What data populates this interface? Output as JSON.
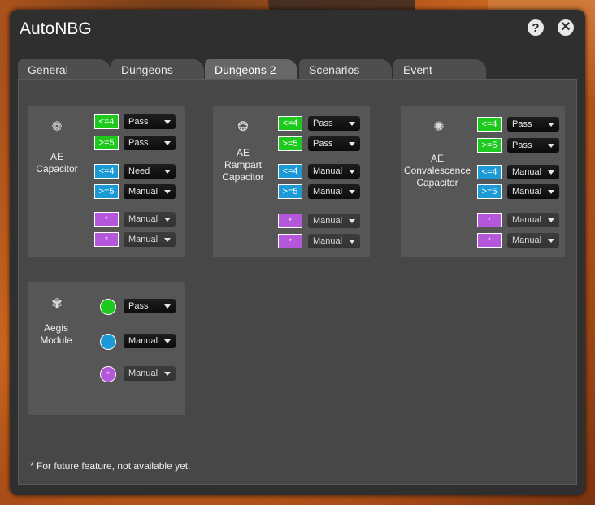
{
  "window": {
    "title": "AutoNBG",
    "help_icon": "?",
    "close_icon": "✕"
  },
  "tabs": [
    {
      "label": "General",
      "active": false
    },
    {
      "label": "Dungeons",
      "active": false
    },
    {
      "label": "Dungeons 2",
      "active": true
    },
    {
      "label": "Scenarios",
      "active": false
    },
    {
      "label": "Event",
      "active": false
    }
  ],
  "colors": {
    "green": "#1cc91c",
    "blue": "#1b9ad6",
    "purple": "#b457db"
  },
  "cards": [
    {
      "name_lines": [
        "AE",
        "Capacitor"
      ],
      "icon": "capacitor-icon",
      "rows": [
        {
          "tag": "<=4",
          "value": "Pass"
        },
        {
          "tag": ">=5",
          "value": "Pass"
        },
        {
          "tag": "<=4",
          "value": "Need"
        },
        {
          "tag": ">=5",
          "value": "Manual"
        },
        {
          "tag": "*",
          "value": "Manual"
        },
        {
          "tag": "*",
          "value": "Manual"
        }
      ]
    },
    {
      "name_lines": [
        "AE",
        "Rampart",
        "Capacitor"
      ],
      "icon": "rampart-capacitor-icon",
      "rows": [
        {
          "tag": "<=4",
          "value": "Pass"
        },
        {
          "tag": ">=5",
          "value": "Pass"
        },
        {
          "tag": "<=4",
          "value": "Manual"
        },
        {
          "tag": ">=5",
          "value": "Manual"
        },
        {
          "tag": "*",
          "value": "Manual"
        },
        {
          "tag": "*",
          "value": "Manual"
        }
      ]
    },
    {
      "name_lines": [
        "AE",
        "Convalescence",
        "Capacitor"
      ],
      "icon": "convalescence-capacitor-icon",
      "rows": [
        {
          "tag": "<=4",
          "value": "Pass"
        },
        {
          "tag": ">=5",
          "value": "Pass"
        },
        {
          "tag": "<=4",
          "value": "Manual"
        },
        {
          "tag": ">=5",
          "value": "Manual"
        },
        {
          "tag": "*",
          "value": "Manual"
        },
        {
          "tag": "*",
          "value": "Manual"
        }
      ]
    },
    {
      "name_lines": [
        "Aegis",
        "Module"
      ],
      "icon": "aegis-module-icon",
      "rows": [
        {
          "tag": "",
          "value": "Pass"
        },
        {
          "tag": "",
          "value": "Manual"
        },
        {
          "tag": "*",
          "value": "Manual"
        }
      ]
    }
  ],
  "footnote": "* For future feature, not available yet."
}
